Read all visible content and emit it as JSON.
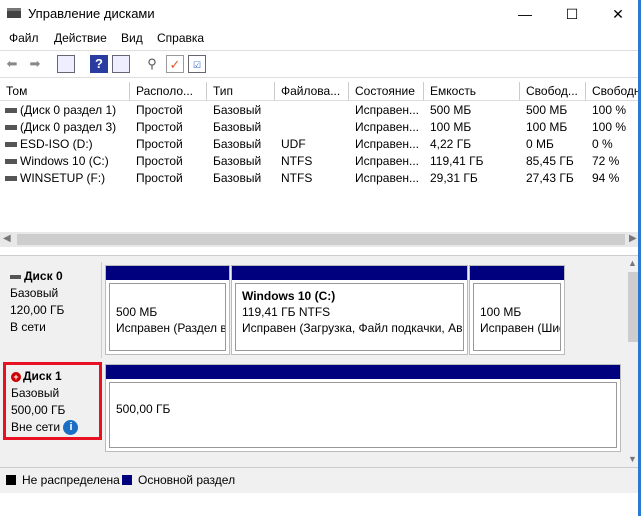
{
  "window": {
    "title": "Управление дисками",
    "minimize": "—",
    "maximize": "☐",
    "close": "✕"
  },
  "menu": [
    "Файл",
    "Действие",
    "Вид",
    "Справка"
  ],
  "toolbar": {
    "icons": [
      "back-arrow-icon",
      "forward-arrow-icon",
      "console-tree-icon",
      "help-icon",
      "action-pane-icon",
      "disk-properties-icon",
      "checklist-icon",
      "settings-list-icon"
    ]
  },
  "table": {
    "headers": [
      "Том",
      "Располо...",
      "Тип",
      "Файлова...",
      "Состояние",
      "Емкость",
      "Свобод...",
      "Свободн"
    ],
    "rows": [
      [
        "(Диск 0 раздел 1)",
        "Простой",
        "Базовый",
        "",
        "Исправен...",
        "500 МБ",
        "500 МБ",
        "100 %"
      ],
      [
        "(Диск 0 раздел 3)",
        "Простой",
        "Базовый",
        "",
        "Исправен...",
        "100 МБ",
        "100 МБ",
        "100 %"
      ],
      [
        "ESD-ISO (D:)",
        "Простой",
        "Базовый",
        "UDF",
        "Исправен...",
        "4,22 ГБ",
        "0 МБ",
        "0 %"
      ],
      [
        "Windows 10 (C:)",
        "Простой",
        "Базовый",
        "NTFS",
        "Исправен...",
        "119,41 ГБ",
        "85,45 ГБ",
        "72 %"
      ],
      [
        "WINSETUP (F:)",
        "Простой",
        "Базовый",
        "NTFS",
        "Исправен...",
        "29,31 ГБ",
        "27,43 ГБ",
        "94 %"
      ]
    ]
  },
  "disks": [
    {
      "name": "Диск 0",
      "type": "Базовый",
      "size": "120,00 ГБ",
      "status": "В сети",
      "partitions": [
        {
          "title": "",
          "size": "500 МБ",
          "status": "Исправен (Раздел восстановления)"
        },
        {
          "title": "Windows 10  (C:)",
          "size": "119,41 ГБ NTFS",
          "status": "Исправен (Загрузка, Файл подкачки, Аварийный дамп)"
        },
        {
          "title": "",
          "size": "100 МБ",
          "status": "Исправен (Шифрованный EFI)"
        }
      ]
    },
    {
      "name": "Диск 1",
      "type": "Базовый",
      "size": "500,00 ГБ",
      "status": "Вне сети",
      "partitions": [
        {
          "title": "",
          "size": "500,00 ГБ",
          "status": ""
        }
      ]
    }
  ],
  "legend": [
    {
      "label": "Не распределена",
      "color": "#000000"
    },
    {
      "label": "Основной раздел",
      "color": "#00007f"
    }
  ],
  "colors": {
    "partition_bar": "#00007f",
    "highlight": "#e81123",
    "info": "#1a6fc4"
  }
}
